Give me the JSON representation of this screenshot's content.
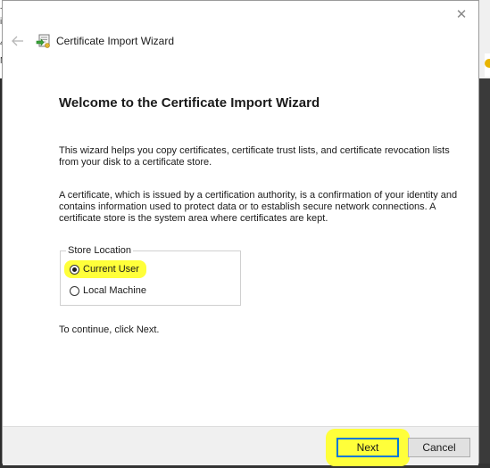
{
  "window": {
    "title": "Certificate Import Wizard",
    "close_glyph": "✕"
  },
  "page": {
    "heading": "Welcome to the Certificate Import Wizard",
    "intro": "This wizard helps you copy certificates, certificate trust lists, and certificate revocation lists from your disk to a certificate store.",
    "explanation": "A certificate, which is issued by a certification authority, is a confirmation of your identity and contains information used to protect data or to establish secure network connections. A certificate store is the system area where certificates are kept.",
    "continue_hint": "To continue, click Next."
  },
  "store_location": {
    "legend": "Store Location",
    "options": [
      {
        "label": "Current User",
        "selected": true
      },
      {
        "label": "Local Machine",
        "selected": false
      }
    ]
  },
  "buttons": {
    "next": "Next",
    "cancel": "Cancel"
  },
  "background": {
    "left_glyphs": [
      "+",
      "i",
      "4",
      "M"
    ]
  },
  "colors": {
    "highlight": "#ffff3a",
    "focus_border": "#0078d7"
  },
  "icons": {
    "back": "back-arrow-icon",
    "wizard": "certificate-wizard-icon",
    "close": "close-icon"
  }
}
